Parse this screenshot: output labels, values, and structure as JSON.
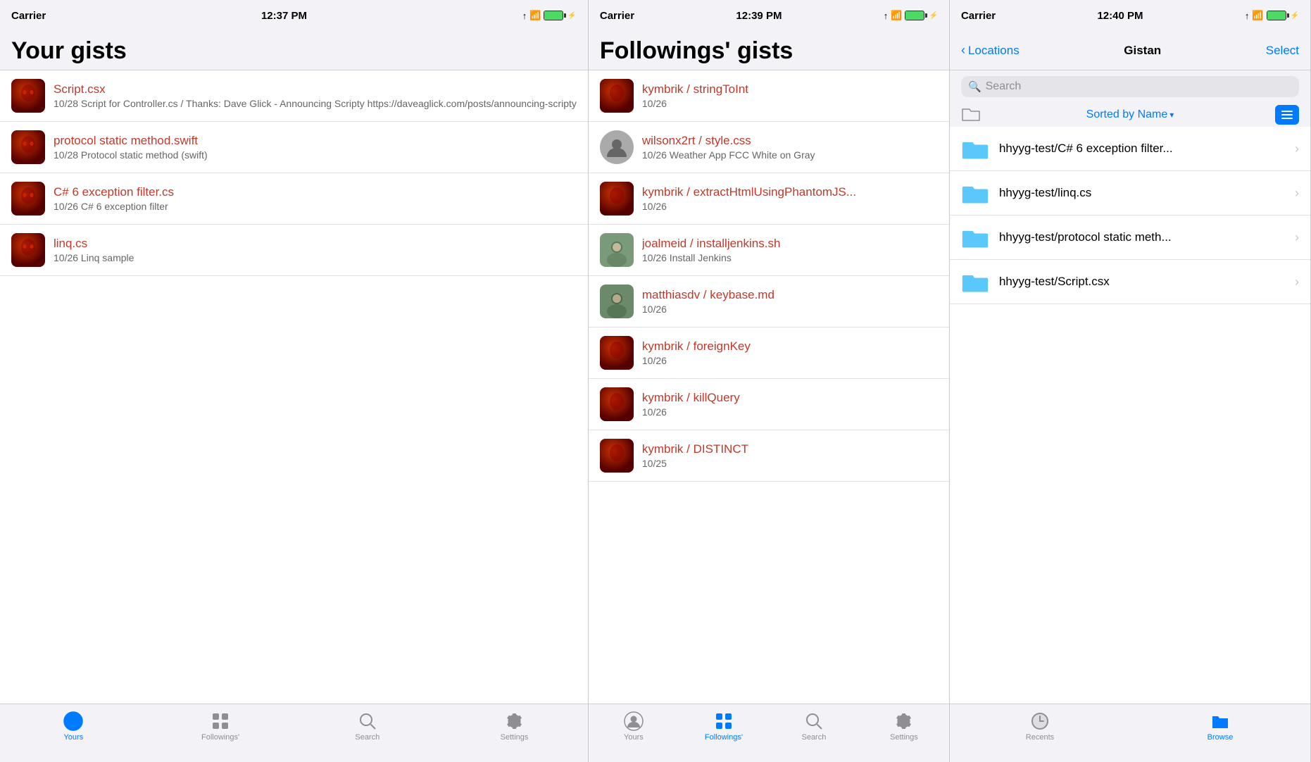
{
  "panel1": {
    "statusBar": {
      "carrier": "Carrier",
      "time": "12:37 PM"
    },
    "title": "Your gists",
    "items": [
      {
        "title": "Script.csx",
        "subtitle": "10/28 Script for Controller.cs / Thanks: Dave Glick - Announcing Scripty https://daveaglick.com/posts/announcing-scripty",
        "avatarType": "red"
      },
      {
        "title": "protocol static method.swift",
        "subtitle": "10/28 Protocol static method (swift)",
        "avatarType": "red"
      },
      {
        "title": "C# 6 exception filter.cs",
        "subtitle": "10/26 C# 6 exception filter",
        "avatarType": "red"
      },
      {
        "title": "linq.cs",
        "subtitle": "10/26 Linq sample",
        "avatarType": "red"
      }
    ],
    "tabs": [
      {
        "label": "Yours",
        "active": true,
        "icon": "person-circle"
      },
      {
        "label": "Followings'",
        "active": false,
        "icon": "grid"
      },
      {
        "label": "Search",
        "active": false,
        "icon": "search"
      },
      {
        "label": "Settings",
        "active": false,
        "icon": "gear"
      }
    ]
  },
  "panel2": {
    "statusBar": {
      "carrier": "Carrier",
      "time": "12:39 PM"
    },
    "title": "Followings' gists",
    "items": [
      {
        "title": "kymbrik / stringToInt",
        "subtitle": "10/26",
        "avatarType": "red"
      },
      {
        "title": "wilsonx2rt / style.css",
        "subtitle": "10/26 Weather App FCC White on Gray",
        "avatarType": "person"
      },
      {
        "title": "kymbrik / extractHtmlUsingPhantomJS...",
        "subtitle": "10/26",
        "avatarType": "red"
      },
      {
        "title": "joalmeid / installjenkins.sh",
        "subtitle": "10/26 Install Jenkins",
        "avatarType": "photo1"
      },
      {
        "title": "matthiasdv / keybase.md",
        "subtitle": "10/26",
        "avatarType": "photo2"
      },
      {
        "title": "kymbrik / foreignKey",
        "subtitle": "10/26",
        "avatarType": "red"
      },
      {
        "title": "kymbrik / killQuery",
        "subtitle": "10/26",
        "avatarType": "red"
      },
      {
        "title": "kymbrik / DISTINCT",
        "subtitle": "10/25",
        "avatarType": "red"
      }
    ],
    "tabs": [
      {
        "label": "Yours",
        "active": false,
        "icon": "person-circle"
      },
      {
        "label": "Followings'",
        "active": true,
        "icon": "grid"
      },
      {
        "label": "Search",
        "active": false,
        "icon": "search"
      },
      {
        "label": "Settings",
        "active": false,
        "icon": "gear"
      }
    ]
  },
  "panel3": {
    "statusBar": {
      "carrier": "Carrier",
      "time": "12:40 PM"
    },
    "navBack": "Locations",
    "navTitle": "Gistan",
    "navSelect": "Select",
    "searchPlaceholder": "Search",
    "sortLabel": "Sorted by Name",
    "folders": [
      {
        "name": "hhyyg-test/C# 6 exception filter..."
      },
      {
        "name": "hhyyg-test/linq.cs"
      },
      {
        "name": "hhyyg-test/protocol static meth..."
      },
      {
        "name": "hhyyg-test/Script.csx"
      }
    ],
    "tabs": [
      {
        "label": "Recents",
        "active": false,
        "icon": "clock"
      },
      {
        "label": "Browse",
        "active": true,
        "icon": "folder"
      }
    ]
  }
}
